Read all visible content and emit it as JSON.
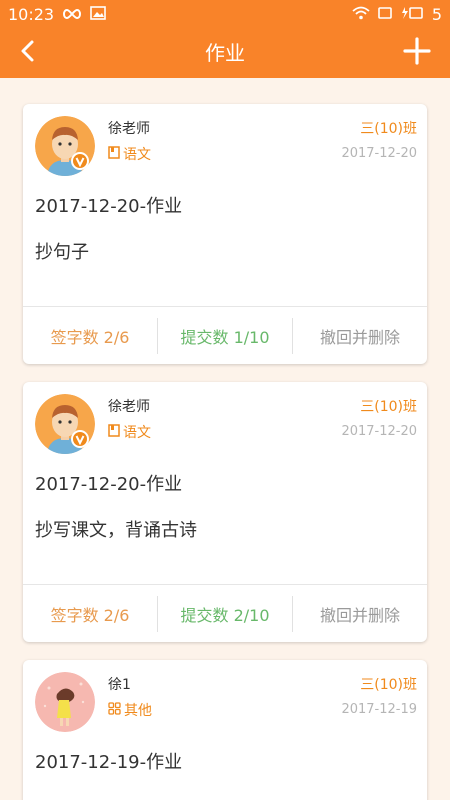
{
  "status_bar": {
    "time": "10:23",
    "battery": "5"
  },
  "nav": {
    "title": "作业"
  },
  "homeworks": [
    {
      "teacher": "徐老师",
      "subject": "语文",
      "class_name": "三(10)班",
      "date": "2017-12-20",
      "title": "2017-12-20-作业",
      "content": "抄句子",
      "sign_label": "签字数 2/6",
      "submit_label": "提交数 1/10",
      "delete_label": "撤回并删除"
    },
    {
      "teacher": "徐老师",
      "subject": "语文",
      "class_name": "三(10)班",
      "date": "2017-12-20",
      "title": "2017-12-20-作业",
      "content": "抄写课文，背诵古诗",
      "sign_label": "签字数 2/6",
      "submit_label": "提交数 2/10",
      "delete_label": "撤回并删除"
    },
    {
      "teacher": "徐1",
      "subject": "其他",
      "class_name": "三(10)班",
      "date": "2017-12-19",
      "title": "2017-12-19-作业"
    }
  ],
  "colors": {
    "accent": "#f98329",
    "subject": "#f08a1c",
    "sign": "#e89a4e",
    "submit": "#68b86a",
    "delete": "#9a9a9a"
  },
  "icons": {
    "back": "chevron-left-icon",
    "add": "plus-icon",
    "subject_chinese": "book-icon",
    "subject_other": "grid-icon",
    "verified": "verified-badge-icon"
  }
}
